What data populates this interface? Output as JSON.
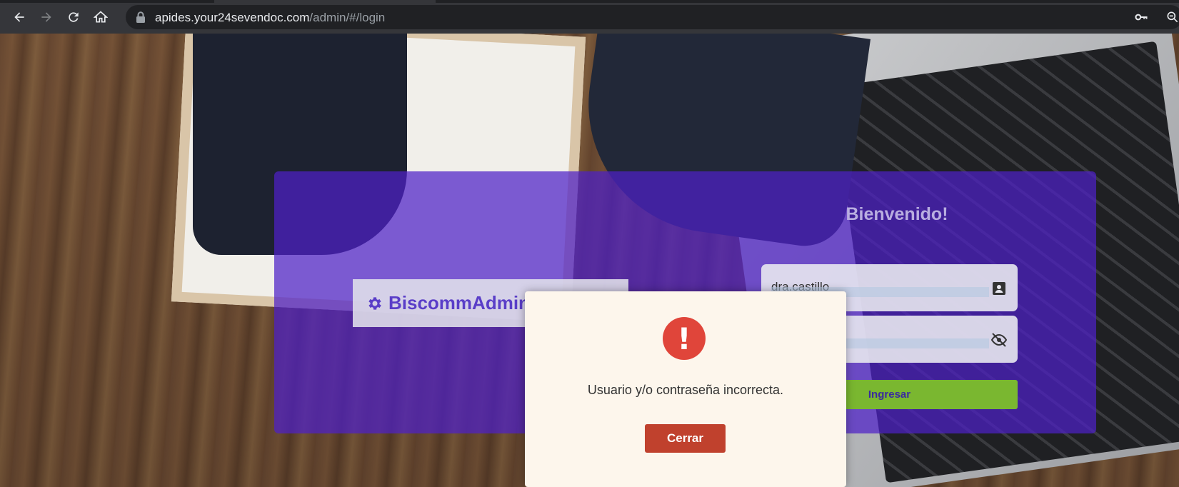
{
  "browser": {
    "url_host": "apides.your24sevendoc.com",
    "url_path": "/admin/#/login",
    "icons": [
      "back-icon",
      "forward-icon",
      "reload-icon",
      "home-icon",
      "lock-icon",
      "key-icon",
      "zoom-icon"
    ]
  },
  "login": {
    "brand_name": "BiscommAdmin",
    "welcome": "Bienvenido!",
    "username_value": "dra.castillo",
    "submit_label": "Ingresar"
  },
  "modal": {
    "icon_symbol": "!",
    "message": "Usuario y/o contraseña incorrecta.",
    "close_label": "Cerrar"
  },
  "colors": {
    "card": "#4d20c8",
    "submit": "#7ab730",
    "alert": "#e0453a",
    "close_button": "#c0412d",
    "modal_bg": "#fdf6ec"
  }
}
